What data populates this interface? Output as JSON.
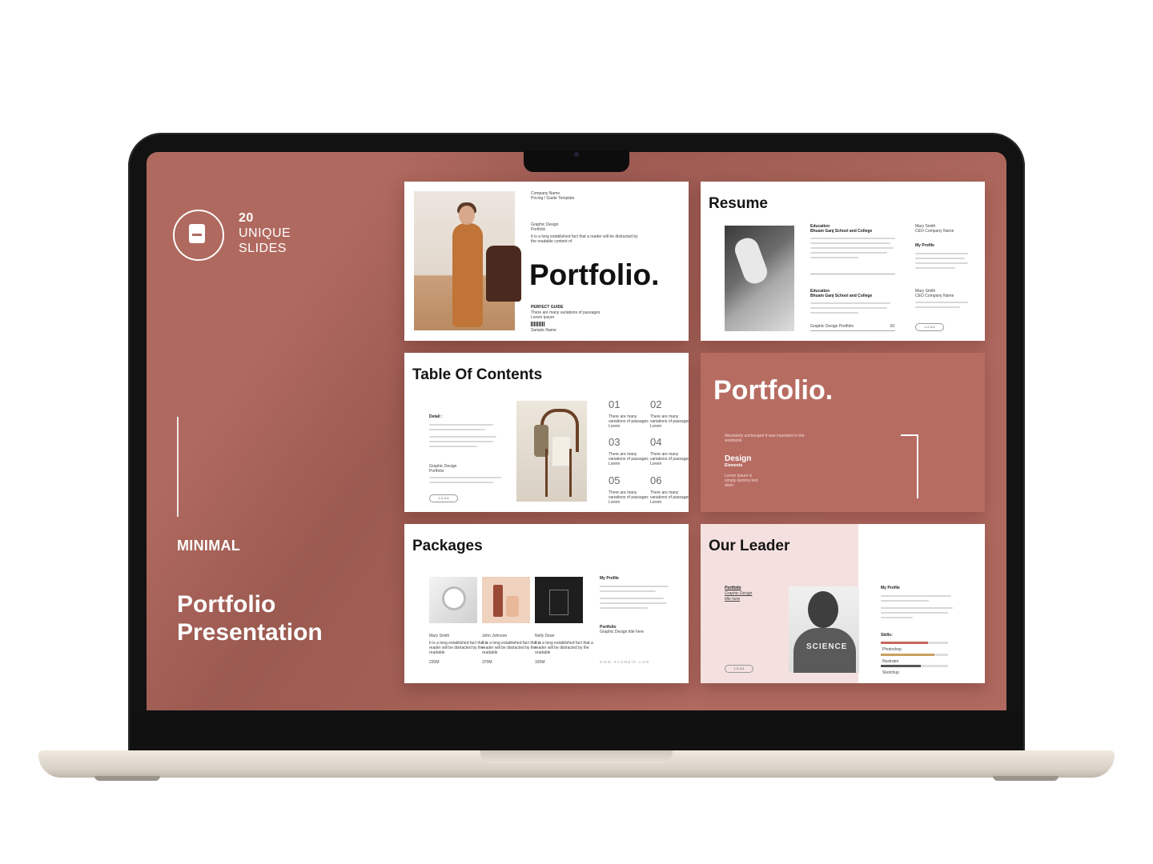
{
  "left_panel": {
    "count": "20",
    "count_line2": "UNIQUE",
    "count_line3": "SLIDES",
    "tag": "MINIMAL",
    "title_line1": "Portfolio",
    "title_line2": "Presentation",
    "icon": "document-icon",
    "accent": "#b0695f"
  },
  "slides": {
    "cover": {
      "company": "Company Name",
      "sub": "Pricing / Guide Template",
      "label1": "Graphic Design",
      "label2": "Portfolio",
      "desc": "It is a long established fact that a reader will be distracted by",
      "desc2": "the readable content of",
      "title": "Portfolio.",
      "guide": "PERFECT GUIDE",
      "guide_desc": "There are many variations of passages",
      "guide_desc2": "Lorem Ipsum",
      "sample": "Sample Name"
    },
    "resume": {
      "title": "Resume",
      "edu1": "Education",
      "edu1_school": "Bhuam Ganj School and College",
      "edu2": "Education",
      "edu2_school": "Bhuam Ganj School and College",
      "footer": "Graphic Design Portfolio",
      "footer_num": "8J",
      "name1": "Mary Smith",
      "name1_sub": "CEO Company Name",
      "profile": "My Profile",
      "name2": "Mary Smith",
      "name2_sub": "CEO Company Name",
      "pill": "1-2-3-4"
    },
    "toc": {
      "title": "Table Of Contents",
      "detail": "Detail :",
      "label": "Graphic Design",
      "label2": "Portfolio",
      "pill": "1-2-3-4",
      "numbers": [
        "01",
        "02",
        "03",
        "04",
        "05",
        "06"
      ],
      "num_desc": "There are many",
      "num_desc2": "variations of passages",
      "num_desc3": "Lorem"
    },
    "divider": {
      "title": "Portfolio.",
      "desc": "Absolutely unchanged It was important in the",
      "desc2": "workbook",
      "sub": "Design",
      "sub2": "Elements",
      "small": "Lorem Ipsum is",
      "small2": "simply dummy text",
      "small3": "dolor"
    },
    "packages": {
      "title": "Packages",
      "items": [
        {
          "name": "Mary Smith",
          "price": "220M"
        },
        {
          "name": "John Johnson",
          "price": "370M"
        },
        {
          "name": "Nelly Dean",
          "price": "320M"
        }
      ],
      "item_desc": "It is a long established fact that a",
      "item_desc2": "reader will be distracted by the",
      "item_desc3": "readable",
      "profile": "My Profile",
      "portfolio": "Portfolio",
      "portfolio_sub": "Graphic Design title here",
      "website": "w w w . e x a m p l e . c o m"
    },
    "leader": {
      "title": "Our Leader",
      "link1": "Portfolio",
      "link2": "Graphic Design",
      "link3": "title here",
      "pill": "1-2-3-4",
      "profile": "My Profile",
      "skills_title": "Skills:",
      "skills": [
        {
          "name": "Photoshop",
          "level": 0.7,
          "color": "#c8645a"
        },
        {
          "name": "Illustrator",
          "level": 0.8,
          "color": "#c8a060"
        },
        {
          "name": "Sketchup",
          "level": 0.6,
          "color": "#555555"
        }
      ],
      "shirt": "SCIENCE"
    }
  }
}
